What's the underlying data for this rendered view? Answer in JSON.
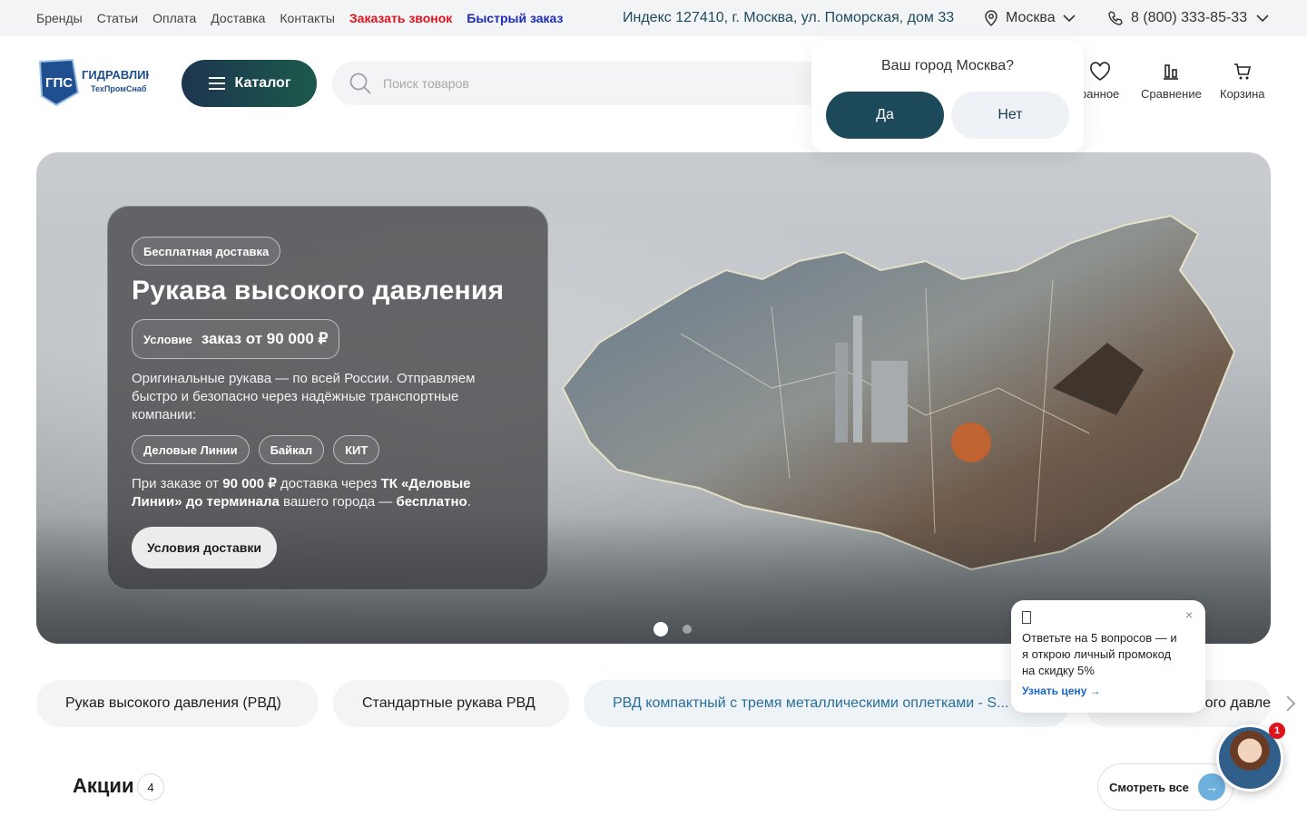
{
  "topbar": {
    "nav": [
      "Бренды",
      "Статьи",
      "Оплата",
      "Доставка",
      "Контакты"
    ],
    "callback": "Заказать звонок",
    "quick_order": "Быстрый заказ",
    "address": "Индекс 127410, г. Москва, ул. Поморская, дом 33",
    "city": "Москва",
    "phone": "8 (800) 333-85-33"
  },
  "header": {
    "logo_text": "ГПС ГИДРАВЛИК ТехПромСнаб",
    "catalog": "Каталог",
    "search_placeholder": "Поиск товаров",
    "favorites": "ранное",
    "compare": "Сравнение",
    "cart": "Корзина"
  },
  "city_popup": {
    "question": "Ваш город Москва?",
    "yes": "Да",
    "no": "Нет"
  },
  "hero": {
    "chip": "Бесплатная доставка",
    "title": "Рукава высокого давления",
    "condition_label": "Условие",
    "condition_value": "заказ от 90 000 ₽",
    "description": "Оригинальные рукава — по всей России. Отправляем быстро и безопасно через надёжные транспортные компании:",
    "carriers": [
      "Деловые Линии",
      "Байкал",
      "КИТ"
    ],
    "note_parts": [
      "При заказе от ",
      "90 000 ₽",
      " доставка через ",
      "ТК «Деловые Линии» до терминала",
      " вашего города — ",
      "бесплатно",
      "."
    ],
    "cta": "Условия доставки",
    "slides": 2,
    "active_slide": 1
  },
  "categories": [
    "Рукав высокого давления (РВД)",
    "Стандартные рукава РВД",
    "РВД компактный с тремя металлическими оплетками - S...",
    "ого давле"
  ],
  "quiz": {
    "text": "Ответьте на 5 вопросов — и я открою личный промокод на скидку 5%",
    "link": "Узнать цену →",
    "close": "×"
  },
  "promos": {
    "title": "Акции",
    "count": "4",
    "see_all": "Смотреть все"
  },
  "chat": {
    "badge": "1"
  },
  "colors": {
    "brand_dark": "#1d4a5a",
    "callback": "#e0131c",
    "quick_order": "#1d2bb8",
    "active_pill_text": "#2a6d9a"
  }
}
